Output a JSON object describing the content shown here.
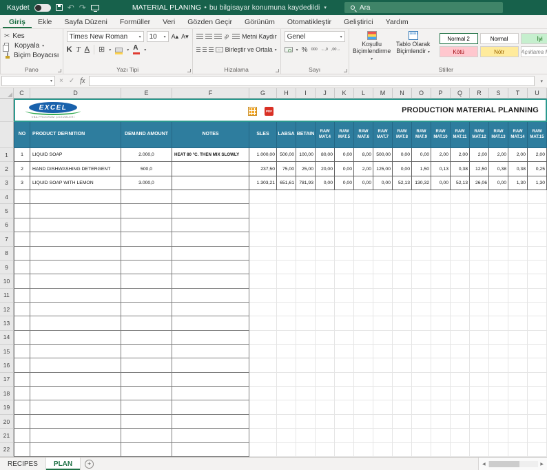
{
  "title_bar": {
    "save_label": "Kaydet",
    "doc_title": "MATERIAL PLANING",
    "separator": "•",
    "doc_status": "bu bilgisayar konumuna kaydedildi",
    "search_placeholder": "Ara"
  },
  "icons": {
    "cut": "✂",
    "dropdown": "▾",
    "undo": "↶",
    "redo": "↷",
    "check": "✓",
    "close": "×",
    "grow_font": "A▴",
    "shrink_font": "A▾",
    "borders": "⊞",
    "percent": "%",
    "thousands": "000",
    "increase_decimal": "←,0",
    "decrease_decimal": ",00→",
    "orientation": "ab",
    "wrap_return": "↩",
    "merge_arrows": "↔",
    "prev": "◀",
    "next": "▶",
    "add": "+"
  },
  "ribbon_tabs": [
    {
      "label": "Giriş",
      "active": true
    },
    {
      "label": "Ekle",
      "active": false
    },
    {
      "label": "Sayfa Düzeni",
      "active": false
    },
    {
      "label": "Formüller",
      "active": false
    },
    {
      "label": "Veri",
      "active": false
    },
    {
      "label": "Gözden Geçir",
      "active": false
    },
    {
      "label": "Görünüm",
      "active": false
    },
    {
      "label": "Otomatikleştir",
      "active": false
    },
    {
      "label": "Geliştirici",
      "active": false
    },
    {
      "label": "Yardım",
      "active": false
    }
  ],
  "ribbon": {
    "clipboard": {
      "cut": "Kes",
      "copy": "Kopyala",
      "format_painter": "Biçim Boyacısı",
      "group_label": "Pano"
    },
    "font": {
      "font_name": "Times New Roman",
      "font_size": "10",
      "bold": "K",
      "italic": "T",
      "underline": "A",
      "group_label": "Yazı Tipi"
    },
    "alignment": {
      "wrap_text": "Metni Kaydır",
      "merge_center": "Birleştir ve Ortala",
      "group_label": "Hizalama"
    },
    "number": {
      "format": "Genel",
      "group_label": "Sayı"
    },
    "styles": {
      "conditional_formatting": "Koşullu Biçimlendirme",
      "format_as_table": "Tablo Olarak Biçimlendir",
      "gallery": [
        {
          "label": "Normal 2",
          "style": "selected"
        },
        {
          "label": "Normal",
          "style": "normal"
        },
        {
          "label": "İyi",
          "style": "good"
        },
        {
          "label": "Kötü",
          "style": "bad"
        },
        {
          "label": "Nötr",
          "style": "neutral"
        },
        {
          "label": "Açıklama Metni",
          "style": "explanatory"
        }
      ],
      "group_label": "Stiller"
    }
  },
  "formula_bar": {
    "name_box": "",
    "fx_label": "fx"
  },
  "grid": {
    "column_letters": [
      "C",
      "D",
      "E",
      "F",
      "G",
      "H",
      "I",
      "J",
      "K",
      "L",
      "M",
      "N",
      "O",
      "P",
      "Q",
      "R",
      "S",
      "T",
      "U"
    ],
    "row_numbers": [
      "1",
      "2",
      "3",
      "4",
      "5",
      "6",
      "7",
      "8",
      "9",
      "10",
      "11",
      "12",
      "13",
      "14",
      "15",
      "16",
      "17",
      "18",
      "19",
      "20",
      "21",
      "22"
    ]
  },
  "sheet": {
    "logo_text": "EXCEL",
    "logo_subtext": "VBA PROGRAM ÇÖZÜMLERİ",
    "pdf_icon_label": "PDF",
    "title": "PRODUCTION MATERIAL PLANNING",
    "table": {
      "headers": [
        "NO",
        "PRODUCT DEFINITION",
        "DEMAND AMOUNT",
        "NOTES",
        "SLES",
        "LABSA",
        "BETAIN",
        "RAW MAT.4",
        "RAW MAT.5",
        "RAW MAT.6",
        "RAW MAT.7",
        "RAW MAT.8",
        "RAW MAT.9",
        "RAW MAT.10",
        "RAW MAT.11",
        "RAW MAT.12",
        "RAW MAT.13",
        "RAW MAT.14",
        "RAW MAT.15"
      ],
      "rows": [
        [
          "1",
          "LIQUID SOAP",
          "2.000,0",
          "HEAT 80 °C. THEN MIX SLOWLY",
          "1.000,00",
          "500,00",
          "100,00",
          "80,00",
          "0,00",
          "8,00",
          "500,00",
          "0,00",
          "0,00",
          "2,00",
          "2,00",
          "2,00",
          "2,00",
          "2,00",
          "2,00"
        ],
        [
          "2",
          "HAND DISHWASHING DETERGENT",
          "500,0",
          "",
          "237,50",
          "75,00",
          "25,00",
          "20,00",
          "0,00",
          "2,00",
          "125,00",
          "0,00",
          "1,50",
          "0,13",
          "0,38",
          "12,50",
          "0,38",
          "0,38",
          "0,25"
        ],
        [
          "3",
          "LIQUID SOAP WITH LEMON",
          "3.000,0",
          "",
          "1.303,21",
          "651,61",
          "781,93",
          "0,00",
          "0,00",
          "0,00",
          "0,00",
          "52,13",
          "130,32",
          "0,00",
          "52,13",
          "26,06",
          "0,00",
          "1,30",
          "1,30"
        ]
      ]
    }
  },
  "sheet_tabs": {
    "tabs": [
      {
        "label": "RECIPES",
        "active": false
      },
      {
        "label": "PLAN",
        "active": true
      }
    ]
  }
}
